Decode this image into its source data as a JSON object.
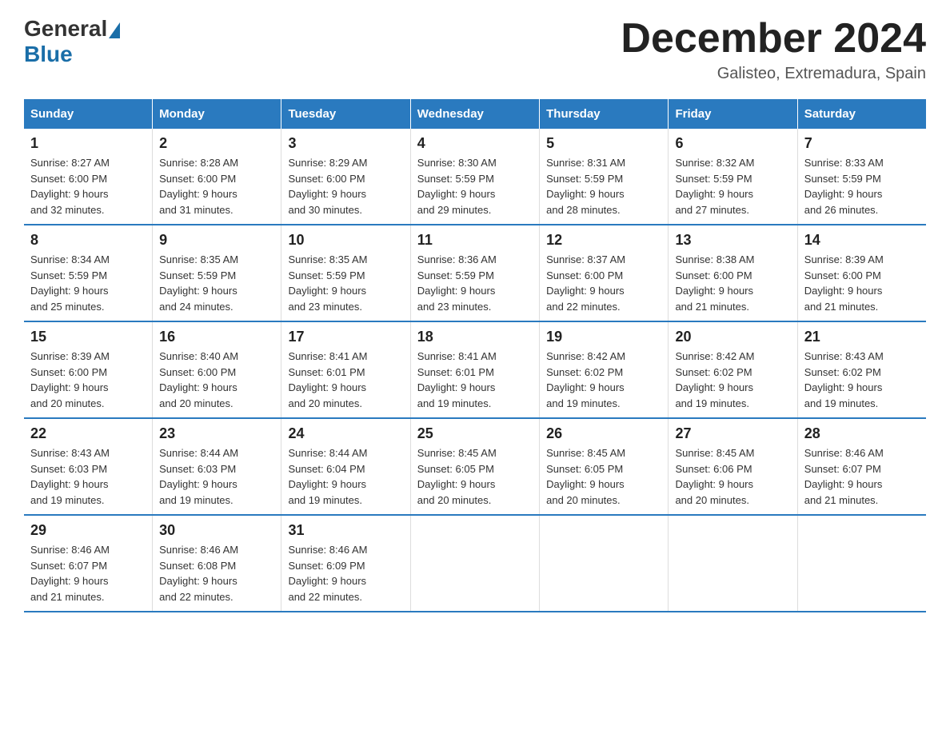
{
  "logo": {
    "general": "General",
    "blue": "Blue"
  },
  "title": "December 2024",
  "location": "Galisteo, Extremadura, Spain",
  "headers": [
    "Sunday",
    "Monday",
    "Tuesday",
    "Wednesday",
    "Thursday",
    "Friday",
    "Saturday"
  ],
  "weeks": [
    [
      {
        "day": "1",
        "sunrise": "8:27 AM",
        "sunset": "6:00 PM",
        "daylight": "9 hours and 32 minutes."
      },
      {
        "day": "2",
        "sunrise": "8:28 AM",
        "sunset": "6:00 PM",
        "daylight": "9 hours and 31 minutes."
      },
      {
        "day": "3",
        "sunrise": "8:29 AM",
        "sunset": "6:00 PM",
        "daylight": "9 hours and 30 minutes."
      },
      {
        "day": "4",
        "sunrise": "8:30 AM",
        "sunset": "5:59 PM",
        "daylight": "9 hours and 29 minutes."
      },
      {
        "day": "5",
        "sunrise": "8:31 AM",
        "sunset": "5:59 PM",
        "daylight": "9 hours and 28 minutes."
      },
      {
        "day": "6",
        "sunrise": "8:32 AM",
        "sunset": "5:59 PM",
        "daylight": "9 hours and 27 minutes."
      },
      {
        "day": "7",
        "sunrise": "8:33 AM",
        "sunset": "5:59 PM",
        "daylight": "9 hours and 26 minutes."
      }
    ],
    [
      {
        "day": "8",
        "sunrise": "8:34 AM",
        "sunset": "5:59 PM",
        "daylight": "9 hours and 25 minutes."
      },
      {
        "day": "9",
        "sunrise": "8:35 AM",
        "sunset": "5:59 PM",
        "daylight": "9 hours and 24 minutes."
      },
      {
        "day": "10",
        "sunrise": "8:35 AM",
        "sunset": "5:59 PM",
        "daylight": "9 hours and 23 minutes."
      },
      {
        "day": "11",
        "sunrise": "8:36 AM",
        "sunset": "5:59 PM",
        "daylight": "9 hours and 23 minutes."
      },
      {
        "day": "12",
        "sunrise": "8:37 AM",
        "sunset": "6:00 PM",
        "daylight": "9 hours and 22 minutes."
      },
      {
        "day": "13",
        "sunrise": "8:38 AM",
        "sunset": "6:00 PM",
        "daylight": "9 hours and 21 minutes."
      },
      {
        "day": "14",
        "sunrise": "8:39 AM",
        "sunset": "6:00 PM",
        "daylight": "9 hours and 21 minutes."
      }
    ],
    [
      {
        "day": "15",
        "sunrise": "8:39 AM",
        "sunset": "6:00 PM",
        "daylight": "9 hours and 20 minutes."
      },
      {
        "day": "16",
        "sunrise": "8:40 AM",
        "sunset": "6:00 PM",
        "daylight": "9 hours and 20 minutes."
      },
      {
        "day": "17",
        "sunrise": "8:41 AM",
        "sunset": "6:01 PM",
        "daylight": "9 hours and 20 minutes."
      },
      {
        "day": "18",
        "sunrise": "8:41 AM",
        "sunset": "6:01 PM",
        "daylight": "9 hours and 19 minutes."
      },
      {
        "day": "19",
        "sunrise": "8:42 AM",
        "sunset": "6:02 PM",
        "daylight": "9 hours and 19 minutes."
      },
      {
        "day": "20",
        "sunrise": "8:42 AM",
        "sunset": "6:02 PM",
        "daylight": "9 hours and 19 minutes."
      },
      {
        "day": "21",
        "sunrise": "8:43 AM",
        "sunset": "6:02 PM",
        "daylight": "9 hours and 19 minutes."
      }
    ],
    [
      {
        "day": "22",
        "sunrise": "8:43 AM",
        "sunset": "6:03 PM",
        "daylight": "9 hours and 19 minutes."
      },
      {
        "day": "23",
        "sunrise": "8:44 AM",
        "sunset": "6:03 PM",
        "daylight": "9 hours and 19 minutes."
      },
      {
        "day": "24",
        "sunrise": "8:44 AM",
        "sunset": "6:04 PM",
        "daylight": "9 hours and 19 minutes."
      },
      {
        "day": "25",
        "sunrise": "8:45 AM",
        "sunset": "6:05 PM",
        "daylight": "9 hours and 20 minutes."
      },
      {
        "day": "26",
        "sunrise": "8:45 AM",
        "sunset": "6:05 PM",
        "daylight": "9 hours and 20 minutes."
      },
      {
        "day": "27",
        "sunrise": "8:45 AM",
        "sunset": "6:06 PM",
        "daylight": "9 hours and 20 minutes."
      },
      {
        "day": "28",
        "sunrise": "8:46 AM",
        "sunset": "6:07 PM",
        "daylight": "9 hours and 21 minutes."
      }
    ],
    [
      {
        "day": "29",
        "sunrise": "8:46 AM",
        "sunset": "6:07 PM",
        "daylight": "9 hours and 21 minutes."
      },
      {
        "day": "30",
        "sunrise": "8:46 AM",
        "sunset": "6:08 PM",
        "daylight": "9 hours and 22 minutes."
      },
      {
        "day": "31",
        "sunrise": "8:46 AM",
        "sunset": "6:09 PM",
        "daylight": "9 hours and 22 minutes."
      },
      null,
      null,
      null,
      null
    ]
  ],
  "labels": {
    "sunrise": "Sunrise:",
    "sunset": "Sunset:",
    "daylight": "Daylight:"
  }
}
